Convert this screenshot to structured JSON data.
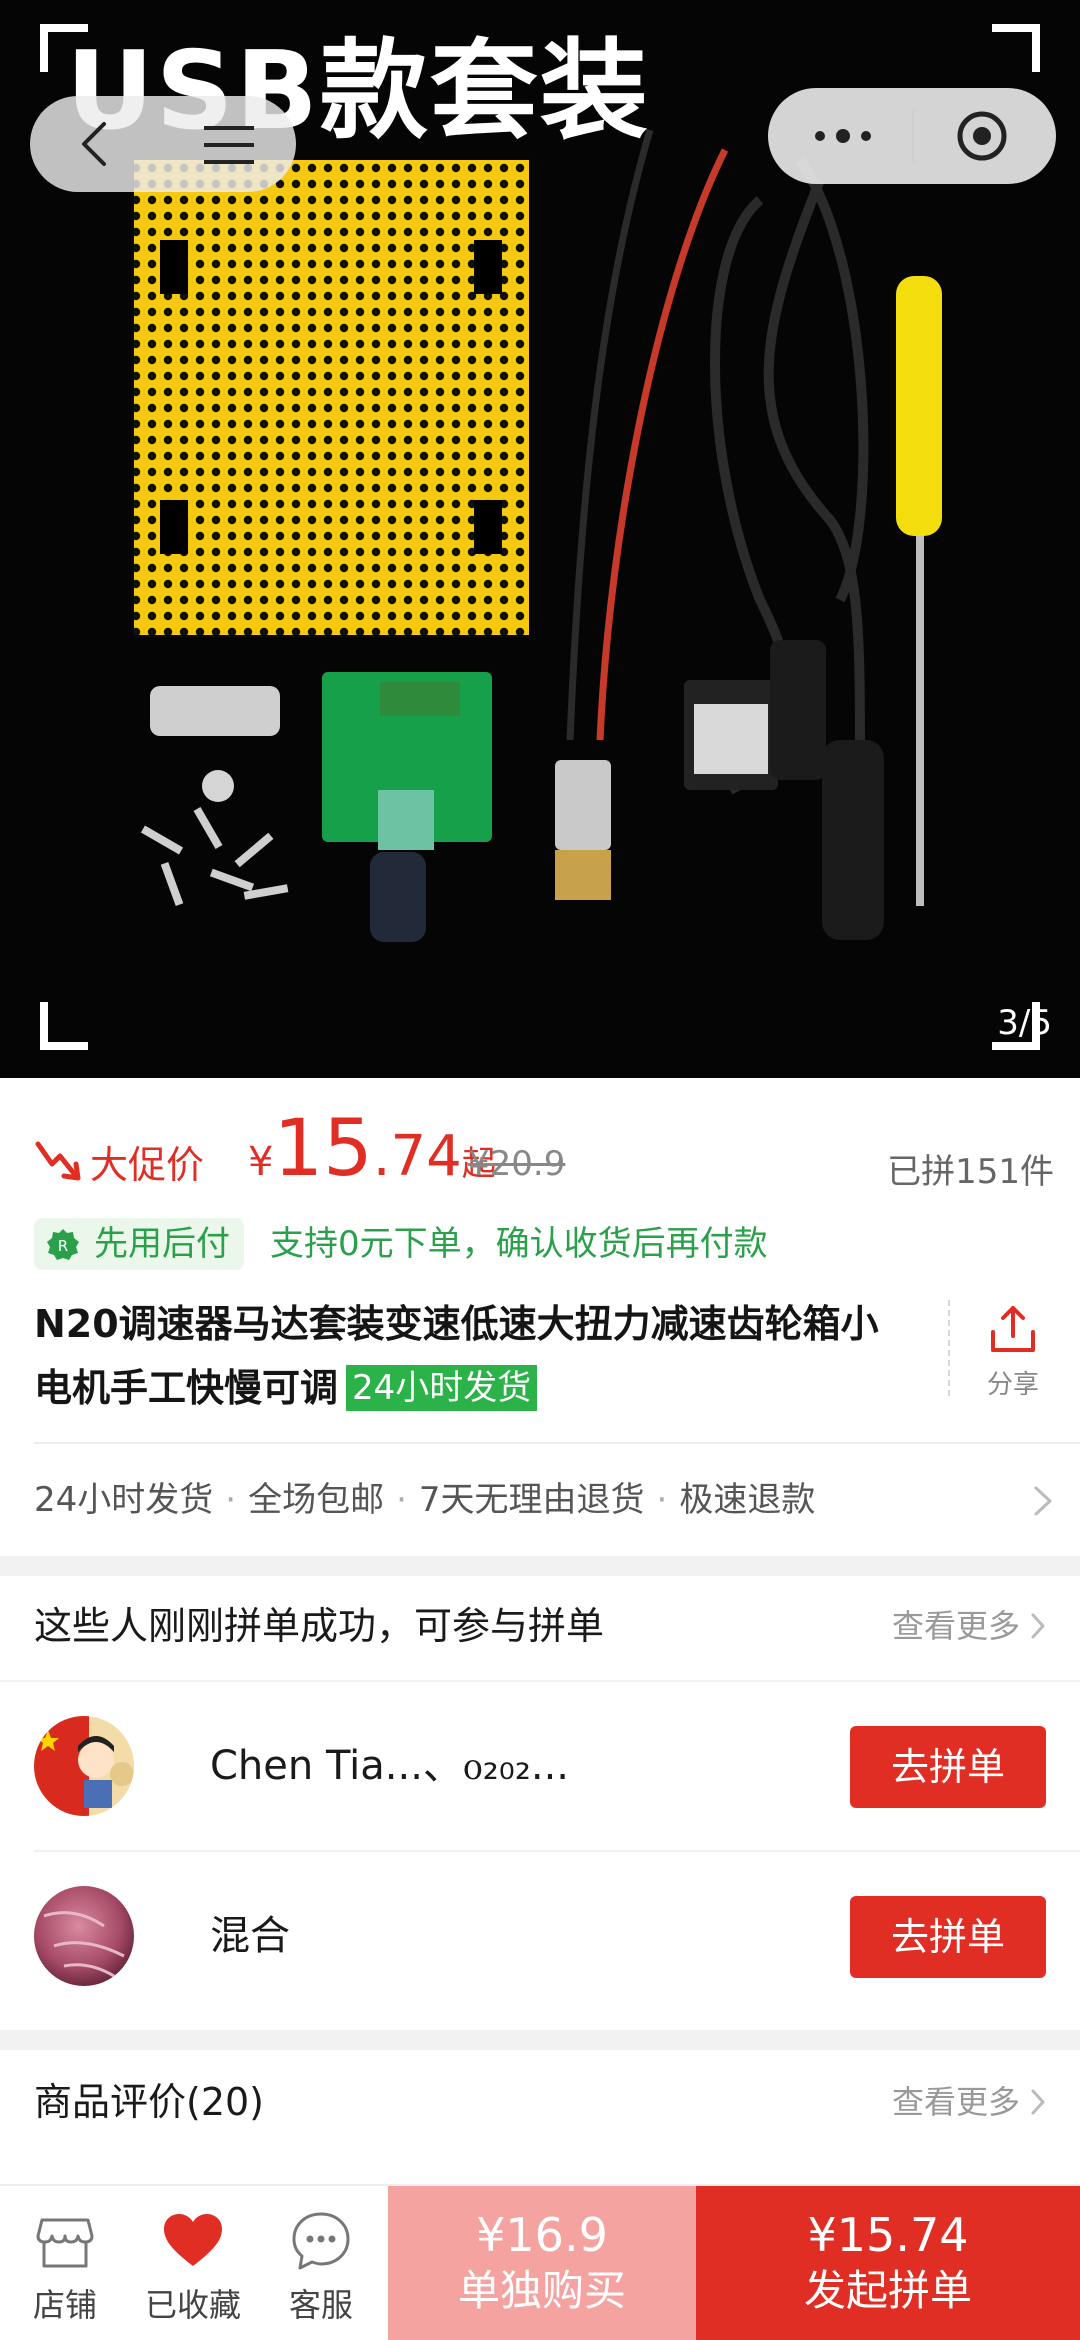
{
  "hero": {
    "title": "USB款套装",
    "counter": "3/5"
  },
  "price": {
    "promo_label": "大促价",
    "currency": "¥",
    "integer": "15",
    "decimal": ".74",
    "suffix": "起",
    "original": "¥20.9",
    "sold": "已拼151件"
  },
  "pay_later": {
    "badge": "先用后付",
    "desc": "支持0元下单，确认收货后再付款"
  },
  "product": {
    "title": "N20调速器马达套装变速低速大扭力减速齿轮箱小电机手工快慢可调",
    "tag": "24小时发货",
    "share_label": "分享"
  },
  "services": [
    "24小时发货",
    "全场包邮",
    "7天无理由退货",
    "极速退款"
  ],
  "group_buy": {
    "title": "这些人刚刚拼单成功，可参与拼单",
    "see_more": "查看更多",
    "items": [
      {
        "name": "Chen Tia...、ᦞ₂₀₂...",
        "action": "去拼单"
      },
      {
        "name": "混合",
        "action": "去拼单"
      }
    ]
  },
  "reviews": {
    "title": "商品评价(20)",
    "see_more": "查看更多"
  },
  "bottom_bar": {
    "store": "店铺",
    "favorited": "已收藏",
    "service": "客服",
    "solo_price": "¥16.9",
    "solo_label": "单独购买",
    "group_price": "¥15.74",
    "group_label": "发起拼单"
  },
  "colors": {
    "accent": "#e02e24",
    "accent_light": "#f4a3a0",
    "green": "#2aa04a"
  }
}
